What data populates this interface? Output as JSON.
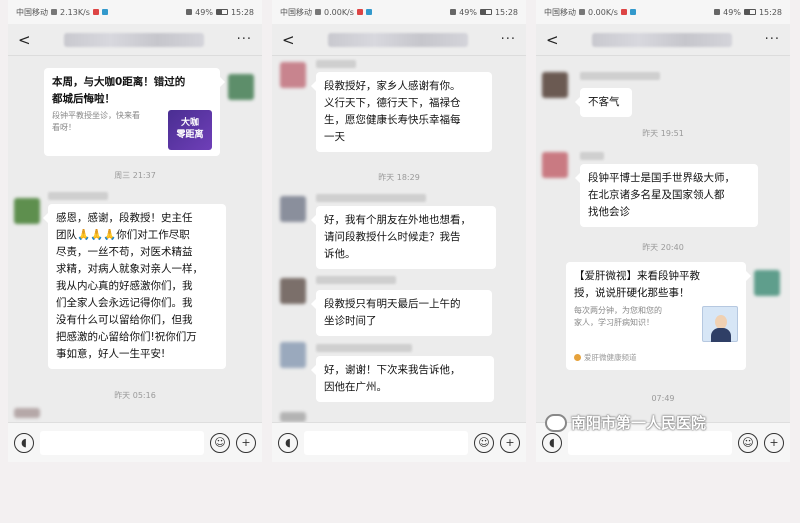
{
  "status_bar": {
    "carrier": "中国移动",
    "speeds": [
      "2.13K/s",
      "0.00K/s",
      "0.00K/s"
    ],
    "battery": "49%",
    "time": "15:28"
  },
  "nav": {
    "back": "<",
    "more": "···"
  },
  "phone1": {
    "msg1": {
      "line1": "本周，与大咖0距离！错过的",
      "line2": "都城后悔啦！",
      "sub1": "段钟平教授坐诊，快来看",
      "sub2": "看呀！",
      "badge1": "大咖",
      "badge2": "零距离"
    },
    "time1": "周三 21:37",
    "msg2": [
      "感恩，感谢，段教授！史主任",
      "团队🙏🙏🙏你们对工作尽职",
      "尽责，一丝不苟，对医术精益",
      "求精，对病人就象对亲人一样，",
      "我从内心真的好感激你们，我",
      "们全家人会永远记得你们。我",
      "没有什么可以留给你们，但我",
      "把感激的心留给你们!祝你们万",
      "事如意，好人一生平安!"
    ],
    "time2": "昨天 05:16"
  },
  "phone2": {
    "msg1": [
      "段教授好，家乡人感谢有你。",
      "义行天下，德行天下，福禄仓",
      "生，愿您健康长寿快乐幸福每",
      "一天"
    ],
    "time1": "昨天 18:29",
    "msg2": [
      "好，我有个朋友在外地也想看，",
      "请问段教授什么时候走？我告",
      "诉他。"
    ],
    "msg3": [
      "段教授只有明天最后一上午的",
      "坐诊时间了"
    ],
    "msg4": [
      "好，谢谢！下次来我告诉他，",
      "因他在广州。"
    ]
  },
  "phone3": {
    "msg1": "不客气",
    "time1": "昨天 19:51",
    "msg2": [
      "段钟平博士是国手世界级大师，",
      "在北京诸多名星及国家领人都",
      "找他会诊"
    ],
    "time2": "昨天 20:40",
    "card": {
      "title1": "【爱肝微视】来看段钟平教",
      "title2": "授，说说肝硬化那些事！",
      "desc1": "每次两分钟，为您和您的",
      "desc2": "家人，学习肝病知识！",
      "source": "爱肝微健康频道"
    },
    "time3": "07:49"
  },
  "watermark": "南阳市第一人民医院",
  "icons": {
    "voice": "voice-icon",
    "emoji": "emoji-icon",
    "plus": "plus-icon"
  }
}
